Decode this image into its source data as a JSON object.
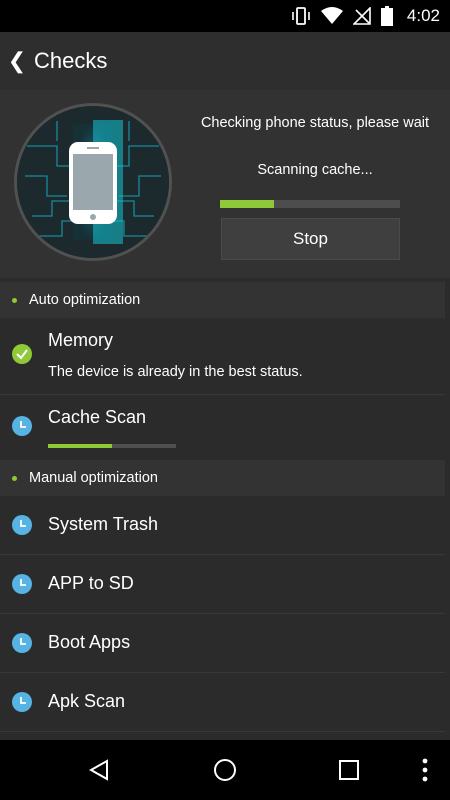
{
  "status_bar": {
    "time": "4:02",
    "icons": [
      "vibrate-icon",
      "wifi-icon",
      "no-signal-icon",
      "battery-icon"
    ]
  },
  "app_bar": {
    "title": "Checks"
  },
  "scan": {
    "status": "Checking phone status, please wait",
    "current_task": "Scanning cache...",
    "progress_fraction": 0.3,
    "stop_label": "Stop"
  },
  "sections": {
    "auto": "Auto optimization",
    "manual": "Manual optimization"
  },
  "auto_items": [
    {
      "label": "Memory",
      "subtitle": "The device is already in the best status.",
      "state": "done"
    },
    {
      "label": "Cache Scan",
      "progress_fraction": 0.5,
      "state": "scanning"
    }
  ],
  "manual_items": [
    {
      "label": "System Trash",
      "state": "pending"
    },
    {
      "label": "APP to SD",
      "state": "pending"
    },
    {
      "label": "Boot Apps",
      "state": "pending"
    },
    {
      "label": "Apk Scan",
      "state": "pending"
    }
  ],
  "colors": {
    "accent_green": "#8fc93a",
    "pending_blue": "#56b3e3",
    "phone_glow": "#19c6d8"
  },
  "nav_bar": {
    "icons": [
      "back-triangle-icon",
      "home-circle-icon",
      "recents-square-icon",
      "overflow-menu-icon"
    ]
  }
}
